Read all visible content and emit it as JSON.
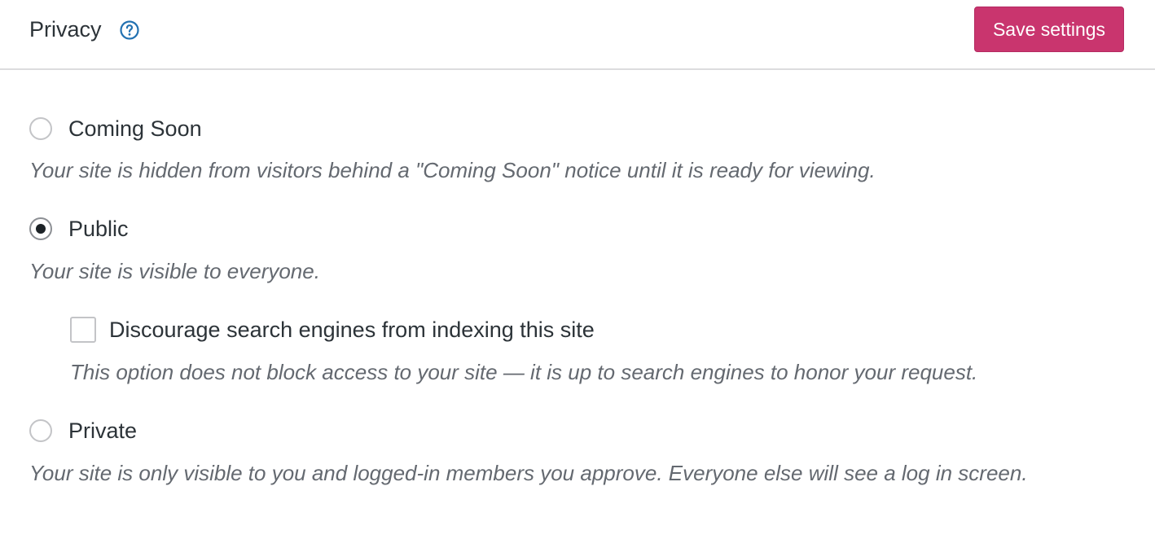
{
  "header": {
    "title": "Privacy",
    "help_icon": "help-circle-icon",
    "save_label": "Save settings"
  },
  "accent_color": "#c9356e",
  "options": {
    "coming_soon": {
      "label": "Coming Soon",
      "description": "Your site is hidden from visitors behind a \"Coming Soon\" notice until it is ready for viewing.",
      "selected": false
    },
    "public": {
      "label": "Public",
      "description": "Your site is visible to everyone.",
      "selected": true,
      "discourage_search": {
        "label": "Discourage search engines from indexing this site",
        "description": "This option does not block access to your site — it is up to search engines to honor your request.",
        "checked": false
      }
    },
    "private": {
      "label": "Private",
      "description": "Your site is only visible to you and logged-in members you approve. Everyone else will see a log in screen.",
      "selected": false
    }
  }
}
